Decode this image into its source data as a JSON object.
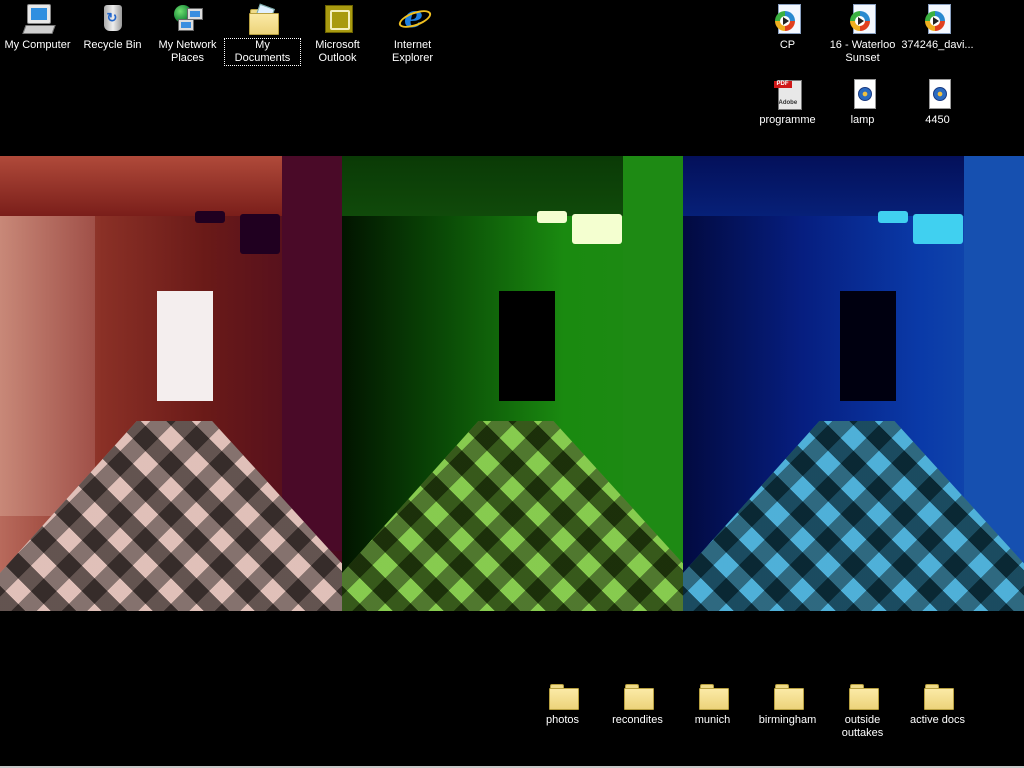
{
  "desktop": {
    "background_color": "#000000",
    "wallpaper": {
      "description": "Hallway photo triptych",
      "panels": [
        {
          "name": "red-tinted-hallway",
          "tint": "#8a3026"
        },
        {
          "name": "green-tinted-hallway",
          "tint": "#1a8a10"
        },
        {
          "name": "blue-tinted-hallway",
          "tint": "#0a3aa8"
        }
      ]
    },
    "icons_left": [
      {
        "label": "My Computer",
        "icon": "my-computer-icon",
        "selected": false
      },
      {
        "label": "Recycle Bin",
        "icon": "recycle-bin-icon",
        "selected": false
      },
      {
        "label": "My Network Places",
        "icon": "network-places-icon",
        "selected": false
      },
      {
        "label": "My Documents",
        "icon": "my-documents-icon",
        "selected": true
      },
      {
        "label": "Microsoft Outlook",
        "icon": "outlook-icon",
        "selected": false
      },
      {
        "label": "Internet Explorer",
        "icon": "internet-explorer-icon",
        "selected": false
      }
    ],
    "icons_right_row1": [
      {
        "label": "CP",
        "icon": "media-file-icon"
      },
      {
        "label": "16 - Waterloo Sunset",
        "icon": "media-file-icon"
      },
      {
        "label": "374246_davi...",
        "icon": "media-file-icon"
      }
    ],
    "icons_right_row2": [
      {
        "label": "programme",
        "icon": "pdf-file-icon"
      },
      {
        "label": "lamp",
        "icon": "quicktime-file-icon"
      },
      {
        "label": "4450",
        "icon": "quicktime-file-icon"
      }
    ],
    "folders_bottom": [
      {
        "label": "photos",
        "icon": "folder-icon"
      },
      {
        "label": "recondites",
        "icon": "folder-icon"
      },
      {
        "label": "munich",
        "icon": "folder-icon"
      },
      {
        "label": "birmingham",
        "icon": "folder-icon"
      },
      {
        "label": "outside outtakes",
        "icon": "folder-icon"
      },
      {
        "label": "active docs",
        "icon": "folder-icon"
      }
    ]
  }
}
